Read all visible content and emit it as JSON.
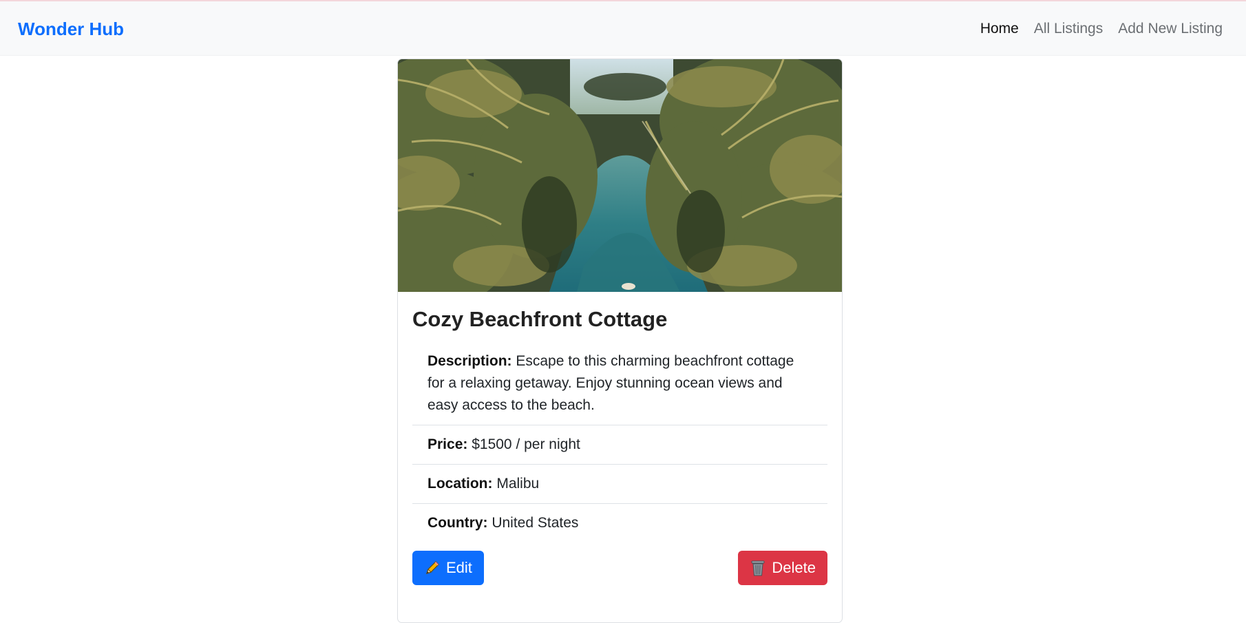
{
  "navbar": {
    "brand": "Wonder Hub",
    "links": [
      {
        "label": "Home",
        "active": true
      },
      {
        "label": "All Listings",
        "active": false
      },
      {
        "label": "Add New Listing",
        "active": false
      }
    ]
  },
  "listing": {
    "image_icon": "tropical-river-photo",
    "title": "Cozy Beachfront Cottage",
    "description_label": "Description:",
    "description": " Escape to this charming beachfront cottage for a relaxing getaway. Enjoy stunning ocean views and easy access to the beach.",
    "price_label": "Price:",
    "price": " $1500 / per night",
    "location_label": "Location:",
    "location": " Malibu",
    "country_label": "Country:",
    "country": " United States"
  },
  "actions": {
    "edit_label": "Edit",
    "edit_icon": "pencil-icon",
    "delete_label": "Delete",
    "delete_icon": "trash-icon"
  },
  "colors": {
    "brand": "#0d6efd",
    "edit_button": "#0d6efd",
    "delete_button": "#dc3545",
    "navbar_bg": "#f8f9fa"
  }
}
